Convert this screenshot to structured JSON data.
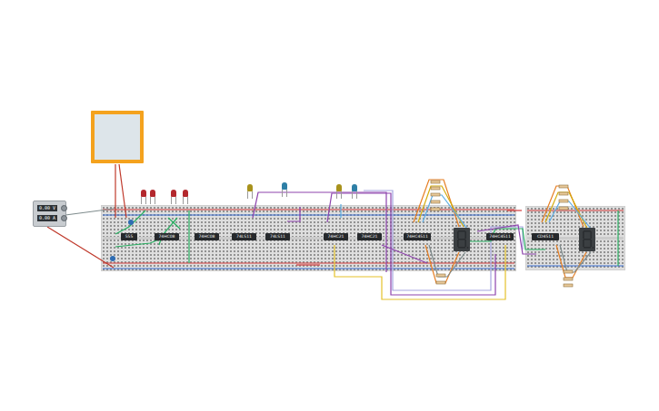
{
  "power_supply": {
    "readings": [
      "0.00 V",
      "0.00 A"
    ]
  },
  "chips": [
    {
      "label": "555"
    },
    {
      "label": "74HC08"
    },
    {
      "label": "74HC08"
    },
    {
      "label": "74LS11"
    },
    {
      "label": "74LS11"
    },
    {
      "label": "74HC21"
    },
    {
      "label": "74HC21"
    },
    {
      "label": "74HC4511"
    },
    {
      "label": "74HC4511"
    },
    {
      "label": "CD4511"
    }
  ],
  "leds": [
    {
      "color": "#b3282d"
    },
    {
      "color": "#b3282d"
    },
    {
      "color": "#b3282d"
    },
    {
      "color": "#b3282d"
    },
    {
      "color": "#a8921c"
    },
    {
      "color": "#2e7fa6"
    },
    {
      "color": "#a8921c"
    },
    {
      "color": "#2e7fa6"
    }
  ],
  "displays": [
    {
      "lit": false
    },
    {
      "lit": false
    }
  ]
}
